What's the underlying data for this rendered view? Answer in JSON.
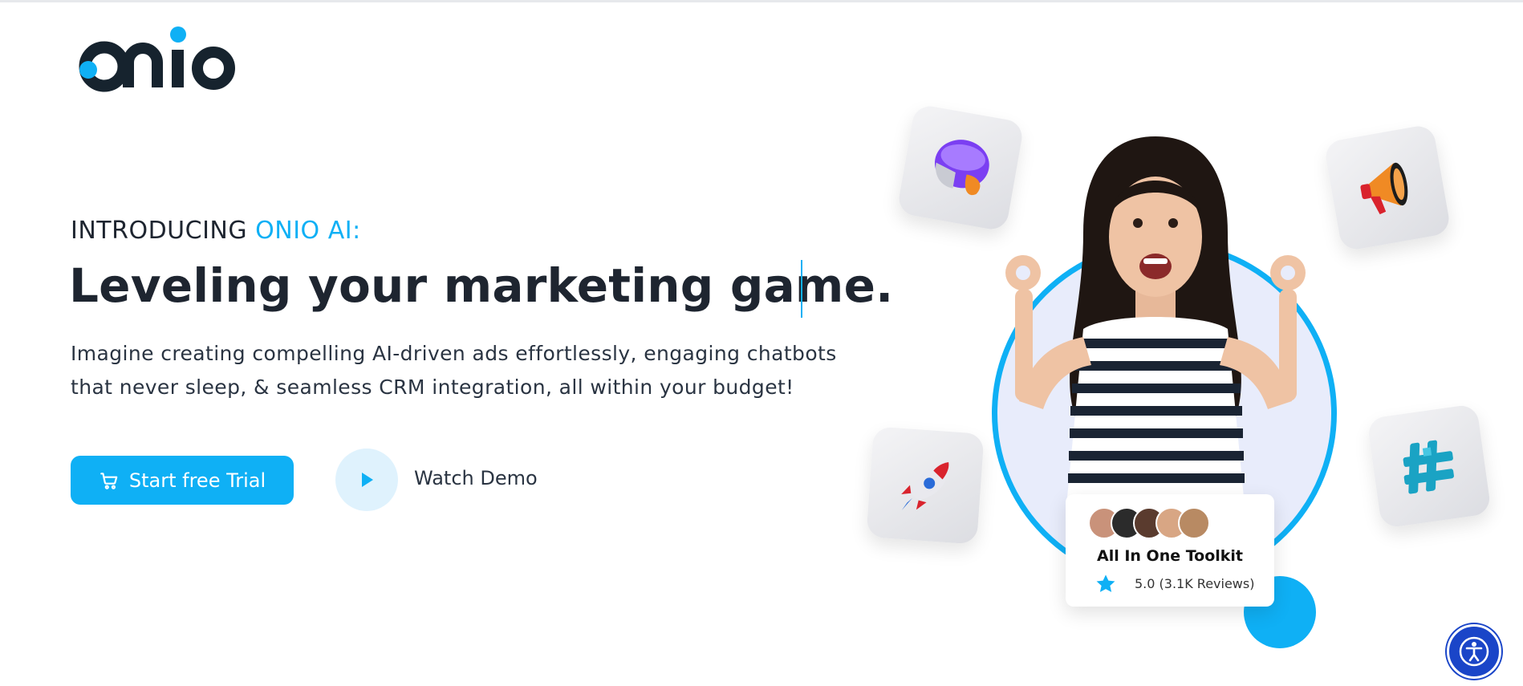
{
  "brand": {
    "name": "Onio",
    "accent_color": "#0fb0f5",
    "dark_color": "#16232e"
  },
  "hero": {
    "intro_prefix": "INTRODUCING ",
    "intro_accent": "ONIO AI:",
    "headline": "Leveling your marketing game.",
    "description": "Imagine creating compelling AI-driven ads effortlessly, engaging chatbots that never sleep, & seamless CRM integration, all within your budget!"
  },
  "cta": {
    "trial_label": "Start free Trial",
    "trial_icon": "cart-icon",
    "demo_label": "Watch Demo",
    "demo_icon": "play-icon"
  },
  "visual": {
    "tiles": [
      "headset-3d-icon",
      "megaphone-3d-icon",
      "rocket-3d-icon",
      "hashtag-3d-icon"
    ],
    "toolkit": {
      "title": "All In One Toolkit",
      "rating": "5.0 (3.1K Reviews)",
      "star_icon": "star-icon"
    }
  },
  "accessibility": {
    "icon": "accessibility-icon"
  }
}
